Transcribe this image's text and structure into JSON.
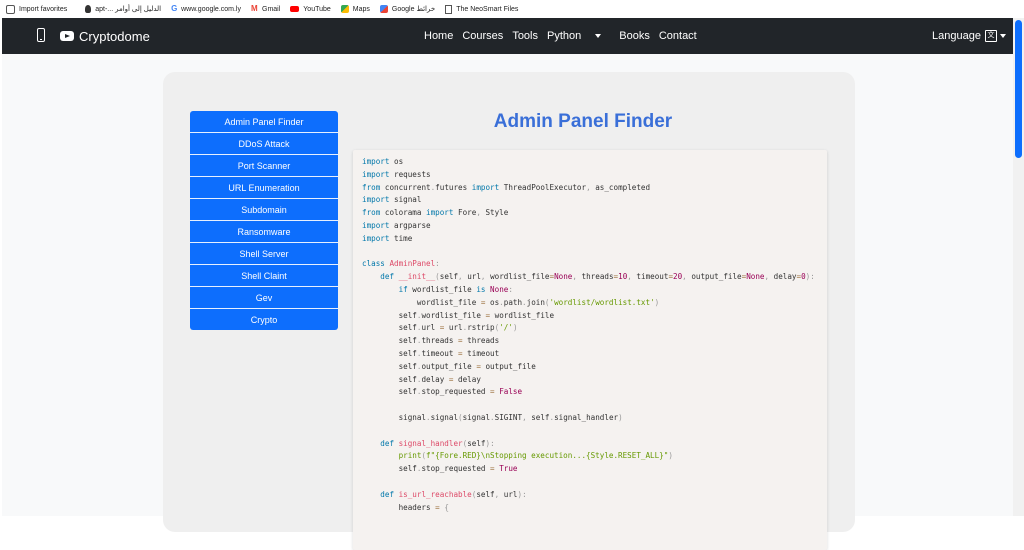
{
  "bookmarks": [
    {
      "label": "Import favorites",
      "icon": "import-icon"
    },
    {
      "label": "apt-... الدليل إلى أوامر",
      "icon": "linux-icon"
    },
    {
      "label": "www.google.com.ly",
      "icon": "google-icon"
    },
    {
      "label": "Gmail",
      "icon": "gmail-icon"
    },
    {
      "label": "YouTube",
      "icon": "youtube-icon"
    },
    {
      "label": "Maps",
      "icon": "maps-icon"
    },
    {
      "label": "Google خرائط",
      "icon": "maps-icon"
    },
    {
      "label": "The NeoSmart Files",
      "icon": "file-icon"
    }
  ],
  "navbar": {
    "brand": "Cryptodome",
    "links": [
      "Home",
      "Courses",
      "Tools",
      "Python",
      "Books",
      "Contact"
    ],
    "language_label": "Language"
  },
  "sidebar": {
    "items": [
      "Admin Panel Finder",
      "DDoS Attack",
      "Port Scanner",
      "URL Enumeration",
      "Subdomain",
      "Ransomware",
      "Shell Server",
      "Shell Claint",
      "Gev",
      "Crypto"
    ]
  },
  "main": {
    "title": "Admin Panel Finder"
  },
  "code_lines": [
    "import os",
    "import requests",
    "from concurrent.futures import ThreadPoolExecutor, as_completed",
    "import signal",
    "from colorama import Fore, Style",
    "import argparse",
    "import time",
    "",
    "class AdminPanel:",
    "    def __init__(self, url, wordlist_file=None, threads=10, timeout=20, output_file=None, delay=0):",
    "        if wordlist_file is None:",
    "            wordlist_file = os.path.join('wordlist/wordlist.txt')",
    "        self.wordlist_file = wordlist_file",
    "        self.url = url.rstrip('/')",
    "        self.threads = threads",
    "        self.timeout = timeout",
    "        self.output_file = output_file",
    "        self.delay = delay",
    "        self.stop_requested = False",
    "",
    "        signal.signal(signal.SIGINT, self.signal_handler)",
    "",
    "    def signal_handler(self):",
    "        print(f\"{Fore.RED}\\nStopping execution...{Style.RESET_ALL}\")",
    "        self.stop_requested = True",
    "",
    "    def is_url_reachable(self, url):",
    "        headers = {"
  ],
  "colors": {
    "navbar_bg": "#212529",
    "accent": "#0d6efd",
    "title": "#3a6fd8",
    "code_bg": "#f5f2f0"
  }
}
